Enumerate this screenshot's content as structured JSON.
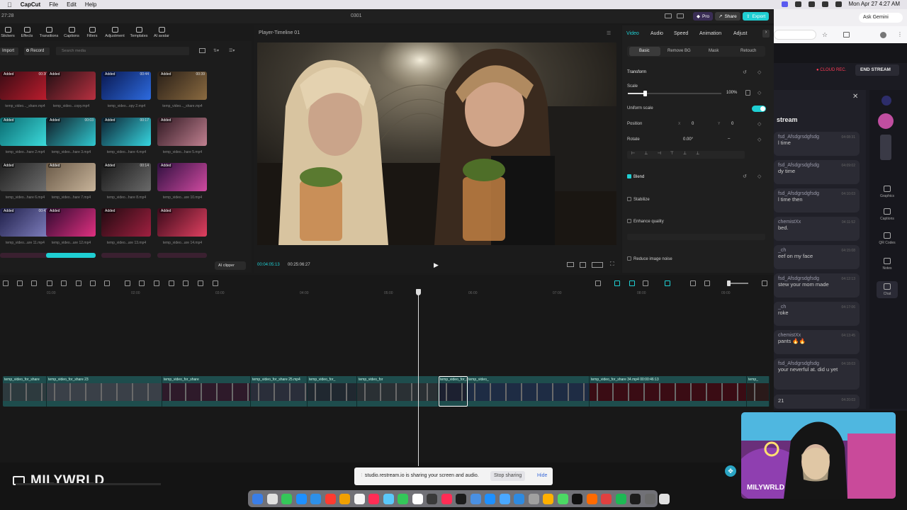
{
  "menubar": {
    "app": "CapCut",
    "file": "File",
    "edit": "Edit",
    "help": "Help",
    "datetime": "Mon Apr 27  4:27 AM"
  },
  "window": {
    "title": "0301",
    "time_left": "27:28",
    "pro": "Pro",
    "share": "Share",
    "export": "Export"
  },
  "toolbar": {
    "items": [
      "Stickers",
      "Effects",
      "Transitions",
      "Captions",
      "Filters",
      "Adjustment",
      "Templates",
      "AI avatar"
    ]
  },
  "media": {
    "import": "Import",
    "record": "Record",
    "search_placeholder": "Search media",
    "ai_clipper": "AI clipper",
    "added": "Added",
    "tiles": [
      {
        "dur": "00:30",
        "name": "temp_video..._share.mp4",
        "c1": "#3a0c14",
        "c2": "#c01d2e"
      },
      {
        "dur": "",
        "name": "temp_video...copy.mp4",
        "c1": "#221014",
        "c2": "#b83040"
      },
      {
        "dur": "00:44",
        "name": "temp_video...opy 2.mp4",
        "c1": "#0a1850",
        "c2": "#2d6be0"
      },
      {
        "dur": "00:39",
        "name": "temp_video..._share.mp4",
        "c1": "#2a2018",
        "c2": "#8a6a40"
      },
      {
        "dur": "",
        "name": "temp_video...hare 2.mp4",
        "c1": "#0a6a70",
        "c2": "#3ee0e0"
      },
      {
        "dur": "00:03",
        "name": "temp_video...hare 3.mp4",
        "c1": "#101a24",
        "c2": "#30c8d0"
      },
      {
        "dur": "00:17",
        "name": "temp_video...hare 4.mp4",
        "c1": "#0c2030",
        "c2": "#36d6e0"
      },
      {
        "dur": "",
        "name": "temp_video...hare 5.mp4",
        "c1": "#301822",
        "c2": "#c08090"
      },
      {
        "dur": "",
        "name": "temp_video...hare 6.mp4",
        "c1": "#202020",
        "c2": "#707070"
      },
      {
        "dur": "",
        "name": "temp_video...hare 7.mp4",
        "c1": "#6a5a48",
        "c2": "#c8b49a"
      },
      {
        "dur": "00:14",
        "name": "temp_video...hare 8.mp4",
        "c1": "#181818",
        "c2": "#6a6a6a"
      },
      {
        "dur": "",
        "name": "temp_video...are 10.mp4",
        "c1": "#301040",
        "c2": "#d04aa0"
      },
      {
        "dur": "00:43",
        "name": "temp_video...are 11.mp4",
        "c1": "#20204a",
        "c2": "#8080c0"
      },
      {
        "dur": "",
        "name": "temp_video...are 12.mp4",
        "c1": "#300a30",
        "c2": "#e03080"
      },
      {
        "dur": "",
        "name": "temp_video...are 13.mp4",
        "c1": "#200a10",
        "c2": "#a02040"
      },
      {
        "dur": "",
        "name": "temp_video...are 14.mp4",
        "c1": "#3a0a1a",
        "c2": "#e04060"
      }
    ]
  },
  "player": {
    "title": "Player-Timeline 01",
    "current": "00:04:05:13",
    "total": "00:25:06:27"
  },
  "props": {
    "tabs": [
      "Video",
      "Audio",
      "Speed",
      "Animation",
      "Adjust"
    ],
    "subtabs": [
      "Basic",
      "Remove BG",
      "Mask",
      "Retouch"
    ],
    "transform": "Transform",
    "scale": "Scale",
    "scale_value": "100%",
    "uniform_scale": "Uniform scale",
    "position": "Position",
    "pos_x": "0",
    "pos_y": "0",
    "rotate": "Rotate",
    "rotate_value": "0.00°",
    "rotate_dash": "–",
    "blend": "Blend",
    "stabilize": "Stabilize",
    "enhance": "Enhance quality",
    "reduce_noise": "Reduce image noise",
    "x_label": "X",
    "y_label": "Y"
  },
  "timeline": {
    "ruler": [
      "01:00",
      "02:00",
      "03:00",
      "04:00",
      "05:00",
      "06:00",
      "07:00",
      "08:00",
      "09:00"
    ],
    "segments": [
      "temp_video_for_share",
      "temp_video_for_share 23",
      "temp_video_for_share",
      "temp_video_for_share 25.mp4",
      "temp_video_for_",
      "temp_video_for",
      "temp_video_for_share 32.mp4  00:00:43:11",
      "temp_video_",
      "temp_video_for_share 34.mp4  00:00:46:13",
      "temp_"
    ]
  },
  "browser": {
    "ask_gemini": "Ask Gemini",
    "cloud_rec": "CLOUD REC.",
    "end_stream": "END STREAM",
    "stream": "stream"
  },
  "chat": [
    {
      "user": "fsd_Afsdgrsdgfsdg",
      "text": "l time",
      "time": "04:08:31"
    },
    {
      "user": "fsd_Afsdgrsdgfsdg",
      "text": "dy time",
      "time": "04:09:02"
    },
    {
      "user": "fsd_Afsdgrsdgfsdg",
      "text": "l time then",
      "time": "04:10:03"
    },
    {
      "user": "chemistXx",
      "text": "bed.",
      "time": "04:11:52"
    },
    {
      "user": "_ch",
      "text": "eef on my face",
      "time": "04:15:08"
    },
    {
      "user": "fsd_Afsdgrsdgfsdg",
      "text": "stew your mom made",
      "time": "04:12:13"
    },
    {
      "user": "_ch",
      "text": "roke",
      "time": "04:17:06"
    },
    {
      "user": "chemistXx",
      "text": "pants 🔥🔥",
      "time": "04:13:45"
    },
    {
      "user": "fsd_Afsdgrsdgfsdg",
      "text": "your neverful at. did u yet",
      "time": "04:18:03"
    },
    {
      "user": "",
      "text": "21",
      "time": "04:20:03"
    }
  ],
  "sidebar": [
    "Graphics",
    "Captions",
    "QR Codes",
    "Notes",
    "Chat"
  ],
  "webcam": {
    "name": "MILYWRLD"
  },
  "brand": {
    "name": "MILYWRLD"
  },
  "share_banner": {
    "text": "studio.restream.io is sharing your screen and audio.",
    "stop": "Stop sharing",
    "hide": "Hide"
  },
  "colors": {
    "accent": "#1fcfd3",
    "record": "#ff3b57"
  }
}
